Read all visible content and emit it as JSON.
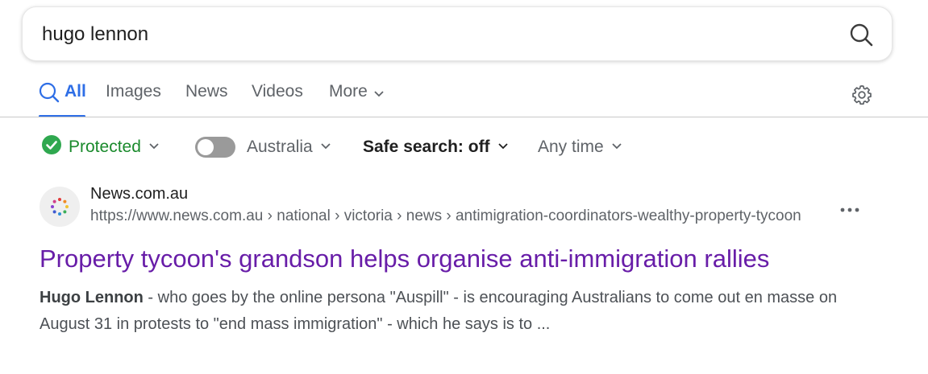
{
  "search": {
    "query": "hugo lennon"
  },
  "tabs": [
    {
      "label": "All"
    },
    {
      "label": "Images"
    },
    {
      "label": "News"
    },
    {
      "label": "Videos"
    },
    {
      "label": "More"
    }
  ],
  "filters": {
    "protected": "Protected",
    "region": "Australia",
    "safe_search": "Safe search: off",
    "time": "Any time"
  },
  "result": {
    "site_name": "News.com.au",
    "url": "https://www.news.com.au › national › victoria › news › antimigration-coordinators-wealthy-property-tycoon",
    "title": "Property tycoon's grandson helps organise anti-immigration rallies",
    "snippet_highlight": "Hugo Lennon",
    "snippet_text": " - who goes by the online persona \"Auspill\" - is encouraging Australians to come out en masse on August 31 in protests to \"end mass immigration\" - which he says is to ..."
  },
  "colors": {
    "accent": "#2e6ee6",
    "protected": "#1a8a2c",
    "visited_link": "#681da8"
  },
  "icons": {
    "search": "search-icon",
    "settings": "gear-icon",
    "check": "check-circle-icon",
    "chevron": "chevron-down-icon",
    "more": "more-horizontal-icon",
    "favicon": "news-favicon"
  }
}
